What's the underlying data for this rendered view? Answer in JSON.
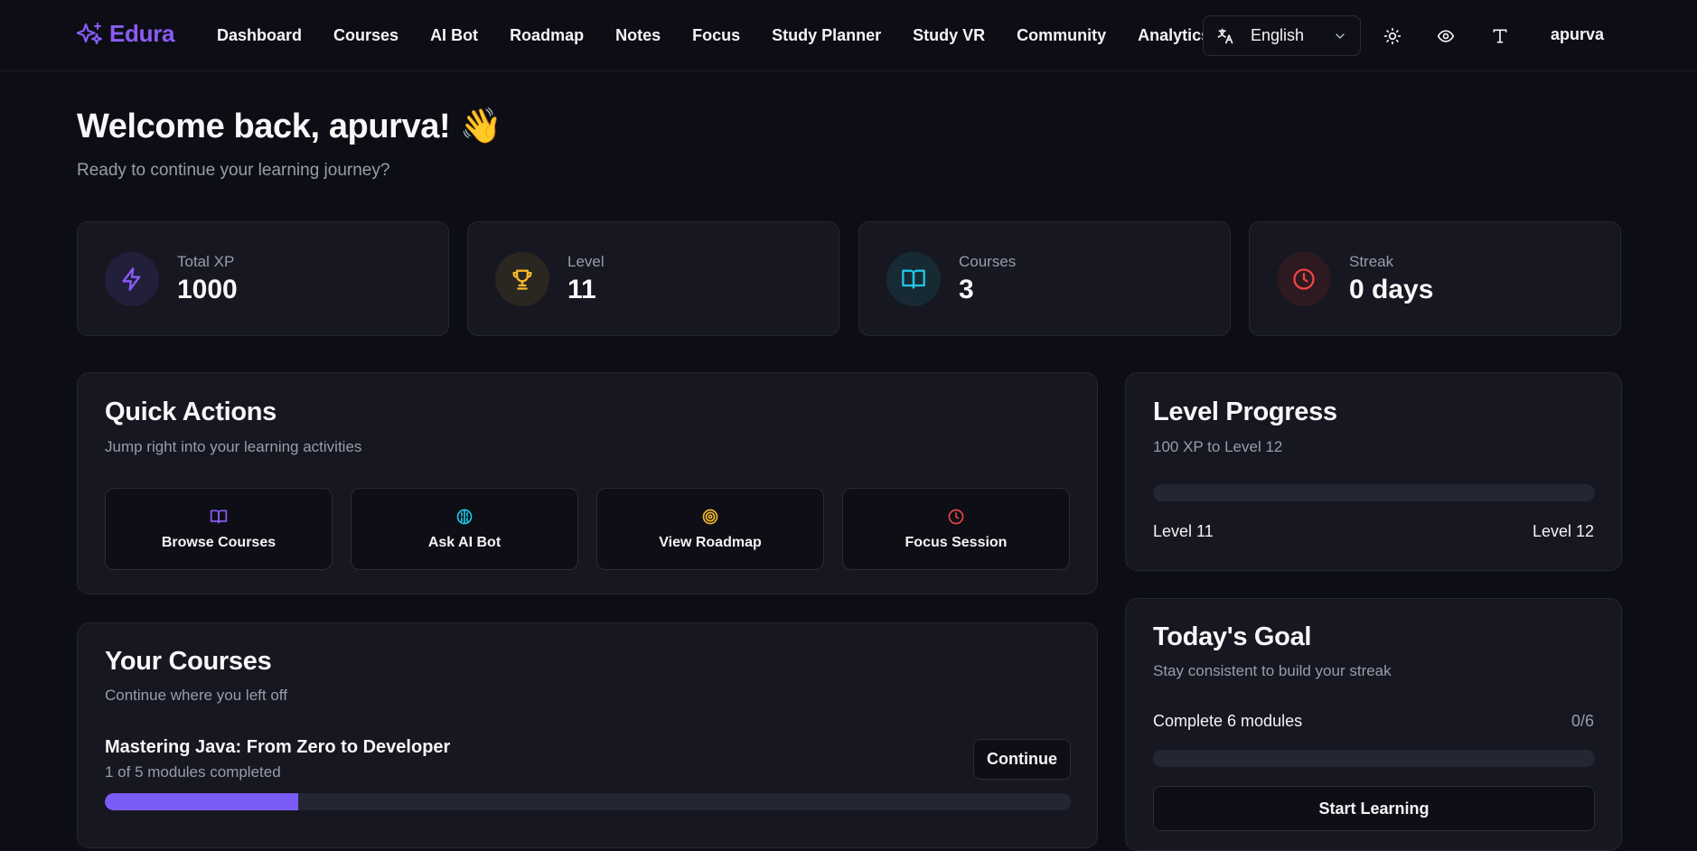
{
  "brand": {
    "name": "Edura"
  },
  "nav": {
    "links": [
      "Dashboard",
      "Courses",
      "AI Bot",
      "Roadmap",
      "Notes",
      "Focus",
      "Study Planner",
      "Study VR",
      "Community",
      "Analytics"
    ],
    "language": "English",
    "username": "apurva",
    "icons": [
      "translate-icon",
      "chevron-down-icon",
      "sun-icon",
      "eye-icon",
      "text-type-icon"
    ]
  },
  "welcome": {
    "title": "Welcome back, apurva! 👋",
    "subtitle": "Ready to continue your learning journey?"
  },
  "stats": [
    {
      "label": "Total XP",
      "value": "1000",
      "icon": "zap-icon",
      "color": "#8b5cf6"
    },
    {
      "label": "Level",
      "value": "11",
      "icon": "trophy-icon",
      "color": "#f5b82e"
    },
    {
      "label": "Courses",
      "value": "3",
      "icon": "book-open-icon",
      "color": "#22c5e6"
    },
    {
      "label": "Streak",
      "value": "0 days",
      "icon": "clock-icon",
      "color": "#ef4444"
    }
  ],
  "quick_actions": {
    "title": "Quick Actions",
    "subtitle": "Jump right into your learning activities",
    "items": [
      {
        "label": "Browse Courses",
        "icon": "book-open-icon",
        "color": "#8b5cf6"
      },
      {
        "label": "Ask AI Bot",
        "icon": "brain-icon",
        "color": "#22c5e6"
      },
      {
        "label": "View Roadmap",
        "icon": "target-icon",
        "color": "#f5b82e"
      },
      {
        "label": "Focus Session",
        "icon": "clock-icon",
        "color": "#ef4444"
      }
    ]
  },
  "courses": {
    "title": "Your Courses",
    "subtitle": "Continue where you left off",
    "items": [
      {
        "name": "Mastering Java: From Zero to Developer",
        "progress_text": "1 of 5 modules completed",
        "progress": 0.2,
        "button": "Continue"
      }
    ]
  },
  "level_progress": {
    "title": "Level Progress",
    "subtitle": "100 XP to Level 12",
    "progress": 0.0,
    "from_label": "Level 11",
    "to_label": "Level 12"
  },
  "todays_goal": {
    "title": "Today's Goal",
    "subtitle": "Stay consistent to build your streak",
    "task": "Complete 6 modules",
    "count": "0/6",
    "progress": 0.0,
    "button": "Start Learning"
  },
  "colors": {
    "accent": "#7c5cf6",
    "background": "#0d0e15",
    "card": "#161720"
  }
}
